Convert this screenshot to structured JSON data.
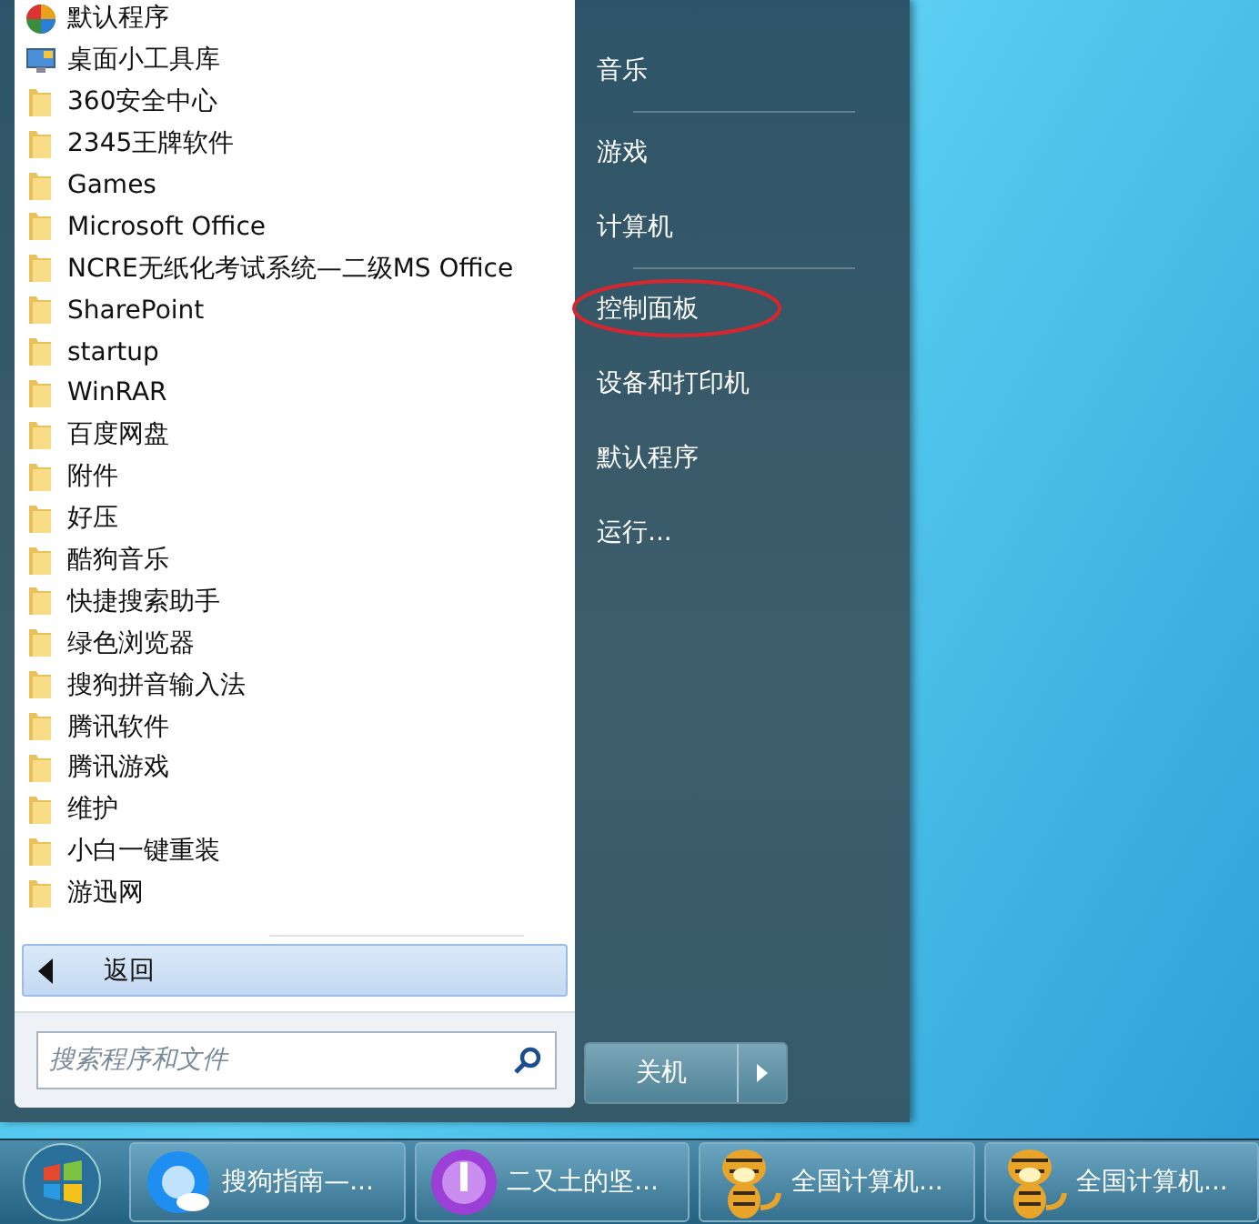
{
  "start_menu": {
    "programs": [
      {
        "label": "默认程序",
        "kind": "orb"
      },
      {
        "label": "桌面小工具库",
        "kind": "gadgets"
      },
      {
        "label": "360安全中心",
        "kind": "folder"
      },
      {
        "label": "2345王牌软件",
        "kind": "folder"
      },
      {
        "label": "Games",
        "kind": "folder"
      },
      {
        "label": "Microsoft Office",
        "kind": "folder"
      },
      {
        "label": "NCRE无纸化考试系统—二级MS Office",
        "kind": "folder"
      },
      {
        "label": "SharePoint",
        "kind": "folder"
      },
      {
        "label": "startup",
        "kind": "folder"
      },
      {
        "label": "WinRAR",
        "kind": "folder"
      },
      {
        "label": "百度网盘",
        "kind": "folder"
      },
      {
        "label": "附件",
        "kind": "folder"
      },
      {
        "label": "好压",
        "kind": "folder"
      },
      {
        "label": "酷狗音乐",
        "kind": "folder"
      },
      {
        "label": "快捷搜索助手",
        "kind": "folder"
      },
      {
        "label": "绿色浏览器",
        "kind": "folder"
      },
      {
        "label": "搜狗拼音输入法",
        "kind": "folder"
      },
      {
        "label": "腾讯软件",
        "kind": "folder"
      },
      {
        "label": "腾讯游戏",
        "kind": "folder"
      },
      {
        "label": "维护",
        "kind": "folder"
      },
      {
        "label": "小白一键重装",
        "kind": "folder"
      },
      {
        "label": "游迅网",
        "kind": "folder"
      }
    ],
    "back_button": "返回",
    "search": {
      "placeholder": "搜索程序和文件"
    },
    "right_items": [
      {
        "kind": "link",
        "label": "音乐",
        "highlighted": false
      },
      {
        "kind": "separator"
      },
      {
        "kind": "link",
        "label": "游戏",
        "highlighted": false
      },
      {
        "kind": "link",
        "label": "计算机",
        "highlighted": false
      },
      {
        "kind": "separator"
      },
      {
        "kind": "link",
        "label": "控制面板",
        "highlighted": true
      },
      {
        "kind": "link",
        "label": "设备和打印机",
        "highlighted": false
      },
      {
        "kind": "link",
        "label": "默认程序",
        "highlighted": false
      },
      {
        "kind": "link",
        "label": "运行...",
        "highlighted": false
      }
    ],
    "shutdown_button": "关机"
  },
  "taskbar": {
    "buttons": [
      {
        "label": "搜狗指南—...",
        "kind": "browser"
      },
      {
        "label": "二又土的坚...",
        "kind": "purple"
      },
      {
        "label": "全国计算机...",
        "kind": "tiger"
      },
      {
        "label": "全国计算机...",
        "kind": "tiger"
      }
    ]
  }
}
